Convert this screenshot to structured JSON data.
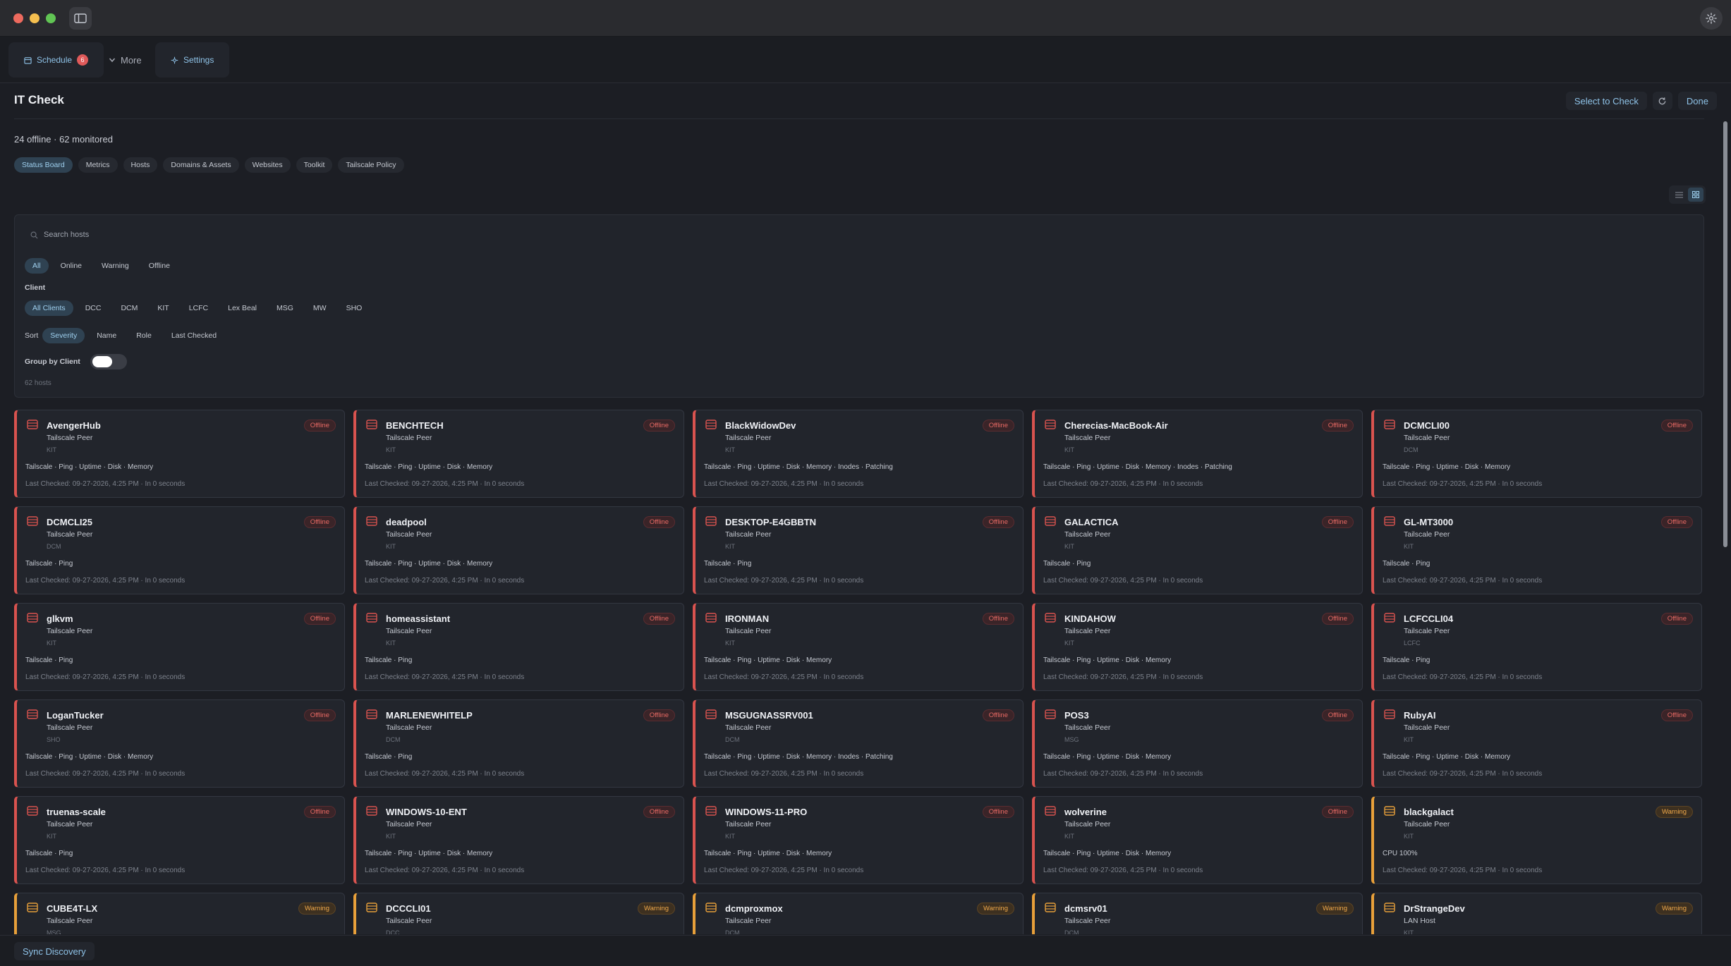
{
  "app": {
    "tabs": {
      "schedule_label": "Schedule",
      "schedule_badge": "6",
      "more_label": "More",
      "settings_label": "Settings"
    }
  },
  "header": {
    "title": "IT Check",
    "select_to_check": "Select to Check",
    "done": "Done",
    "summary": "24 offline · 62 monitored"
  },
  "view_tabs": [
    "Status Board",
    "Metrics",
    "Hosts",
    "Domains & Assets",
    "Websites",
    "Toolkit",
    "Tailscale Policy"
  ],
  "filters": {
    "search_placeholder": "Search hosts",
    "status": [
      "All",
      "Online",
      "Warning",
      "Offline"
    ],
    "client_label": "Client",
    "clients": [
      "All Clients",
      "DCC",
      "DCM",
      "KIT",
      "LCFC",
      "Lex Beal",
      "MSG",
      "MW",
      "SHO"
    ],
    "sort_label": "Sort",
    "sort": [
      "Severity",
      "Name",
      "Role",
      "Last Checked"
    ],
    "group_by_label": "Group by Client",
    "host_count": "62 hosts"
  },
  "hosts": [
    {
      "name": "AvengerHub",
      "role": "Tailscale Peer",
      "client": "KIT",
      "checks": "Tailscale · Ping · Uptime · Disk · Memory",
      "last_checked": "Last Checked: 09-27-2026, 4:25 PM · In 0 seconds",
      "status": "Offline"
    },
    {
      "name": "BENCHTECH",
      "role": "Tailscale Peer",
      "client": "KIT",
      "checks": "Tailscale · Ping · Uptime · Disk · Memory",
      "last_checked": "Last Checked: 09-27-2026, 4:25 PM · In 0 seconds",
      "status": "Offline"
    },
    {
      "name": "BlackWidowDev",
      "role": "Tailscale Peer",
      "client": "KIT",
      "checks": "Tailscale · Ping · Uptime · Disk · Memory · Inodes · Patching",
      "last_checked": "Last Checked: 09-27-2026, 4:25 PM · In 0 seconds",
      "status": "Offline"
    },
    {
      "name": "Cherecias-MacBook-Air",
      "role": "Tailscale Peer",
      "client": "KIT",
      "checks": "Tailscale · Ping · Uptime · Disk · Memory · Inodes · Patching",
      "last_checked": "Last Checked: 09-27-2026, 4:25 PM · In 0 seconds",
      "status": "Offline"
    },
    {
      "name": "DCMCLI00",
      "role": "Tailscale Peer",
      "client": "DCM",
      "checks": "Tailscale · Ping · Uptime · Disk · Memory",
      "last_checked": "Last Checked: 09-27-2026, 4:25 PM · In 0 seconds",
      "status": "Offline"
    },
    {
      "name": "DCMCLI25",
      "role": "Tailscale Peer",
      "client": "DCM",
      "checks": "Tailscale · Ping",
      "last_checked": "Last Checked: 09-27-2026, 4:25 PM · In 0 seconds",
      "status": "Offline"
    },
    {
      "name": "deadpool",
      "role": "Tailscale Peer",
      "client": "KIT",
      "checks": "Tailscale · Ping · Uptime · Disk · Memory",
      "last_checked": "Last Checked: 09-27-2026, 4:25 PM · In 0 seconds",
      "status": "Offline"
    },
    {
      "name": "DESKTOP-E4GBBTN",
      "role": "Tailscale Peer",
      "client": "KIT",
      "checks": "Tailscale · Ping",
      "last_checked": "Last Checked: 09-27-2026, 4:25 PM · In 0 seconds",
      "status": "Offline"
    },
    {
      "name": "GALACTICA",
      "role": "Tailscale Peer",
      "client": "KIT",
      "checks": "Tailscale · Ping",
      "last_checked": "Last Checked: 09-27-2026, 4:25 PM · In 0 seconds",
      "status": "Offline"
    },
    {
      "name": "GL-MT3000",
      "role": "Tailscale Peer",
      "client": "KIT",
      "checks": "Tailscale · Ping",
      "last_checked": "Last Checked: 09-27-2026, 4:25 PM · In 0 seconds",
      "status": "Offline"
    },
    {
      "name": "glkvm",
      "role": "Tailscale Peer",
      "client": "KIT",
      "checks": "Tailscale · Ping",
      "last_checked": "Last Checked: 09-27-2026, 4:25 PM · In 0 seconds",
      "status": "Offline"
    },
    {
      "name": "homeassistant",
      "role": "Tailscale Peer",
      "client": "KIT",
      "checks": "Tailscale · Ping",
      "last_checked": "Last Checked: 09-27-2026, 4:25 PM · In 0 seconds",
      "status": "Offline"
    },
    {
      "name": "IRONMAN",
      "role": "Tailscale Peer",
      "client": "KIT",
      "checks": "Tailscale · Ping · Uptime · Disk · Memory",
      "last_checked": "Last Checked: 09-27-2026, 4:25 PM · In 0 seconds",
      "status": "Offline"
    },
    {
      "name": "KINDAHOW",
      "role": "Tailscale Peer",
      "client": "KIT",
      "checks": "Tailscale · Ping · Uptime · Disk · Memory",
      "last_checked": "Last Checked: 09-27-2026, 4:25 PM · In 0 seconds",
      "status": "Offline"
    },
    {
      "name": "LCFCCLI04",
      "role": "Tailscale Peer",
      "client": "LCFC",
      "checks": "Tailscale · Ping",
      "last_checked": "Last Checked: 09-27-2026, 4:25 PM · In 0 seconds",
      "status": "Offline"
    },
    {
      "name": "LoganTucker",
      "role": "Tailscale Peer",
      "client": "SHO",
      "checks": "Tailscale · Ping · Uptime · Disk · Memory",
      "last_checked": "Last Checked: 09-27-2026, 4:25 PM · In 0 seconds",
      "status": "Offline"
    },
    {
      "name": "MARLENEWHITELP",
      "role": "Tailscale Peer",
      "client": "DCM",
      "checks": "Tailscale · Ping",
      "last_checked": "Last Checked: 09-27-2026, 4:25 PM · In 0 seconds",
      "status": "Offline"
    },
    {
      "name": "MSGUGNASSRV001",
      "role": "Tailscale Peer",
      "client": "DCM",
      "checks": "Tailscale · Ping · Uptime · Disk · Memory · Inodes · Patching",
      "last_checked": "Last Checked: 09-27-2026, 4:25 PM · In 0 seconds",
      "status": "Offline"
    },
    {
      "name": "POS3",
      "role": "Tailscale Peer",
      "client": "MSG",
      "checks": "Tailscale · Ping · Uptime · Disk · Memory",
      "last_checked": "Last Checked: 09-27-2026, 4:25 PM · In 0 seconds",
      "status": "Offline"
    },
    {
      "name": "RubyAI",
      "role": "Tailscale Peer",
      "client": "KIT",
      "checks": "Tailscale · Ping · Uptime · Disk · Memory",
      "last_checked": "Last Checked: 09-27-2026, 4:25 PM · In 0 seconds",
      "status": "Offline"
    },
    {
      "name": "truenas-scale",
      "role": "Tailscale Peer",
      "client": "KIT",
      "checks": "Tailscale · Ping",
      "last_checked": "Last Checked: 09-27-2026, 4:25 PM · In 0 seconds",
      "status": "Offline"
    },
    {
      "name": "WINDOWS-10-ENT",
      "role": "Tailscale Peer",
      "client": "KIT",
      "checks": "Tailscale · Ping · Uptime · Disk · Memory",
      "last_checked": "Last Checked: 09-27-2026, 4:25 PM · In 0 seconds",
      "status": "Offline"
    },
    {
      "name": "WINDOWS-11-PRO",
      "role": "Tailscale Peer",
      "client": "KIT",
      "checks": "Tailscale · Ping · Uptime · Disk · Memory",
      "last_checked": "Last Checked: 09-27-2026, 4:25 PM · In 0 seconds",
      "status": "Offline"
    },
    {
      "name": "wolverine",
      "role": "Tailscale Peer",
      "client": "KIT",
      "checks": "Tailscale · Ping · Uptime · Disk · Memory",
      "last_checked": "Last Checked: 09-27-2026, 4:25 PM · In 0 seconds",
      "status": "Offline"
    },
    {
      "name": "blackgalact",
      "role": "Tailscale Peer",
      "client": "KIT",
      "checks": "CPU 100%",
      "last_checked": "Last Checked: 09-27-2026, 4:25 PM · In 0 seconds",
      "status": "Warning"
    },
    {
      "name": "CUBE4T-LX",
      "role": "Tailscale Peer",
      "client": "MSG",
      "checks": "",
      "last_checked": "",
      "status": "Warning"
    },
    {
      "name": "DCCCLI01",
      "role": "Tailscale Peer",
      "client": "DCC",
      "checks": "",
      "last_checked": "",
      "status": "Warning"
    },
    {
      "name": "dcmproxmox",
      "role": "Tailscale Peer",
      "client": "DCM",
      "checks": "",
      "last_checked": "",
      "status": "Warning"
    },
    {
      "name": "dcmsrv01",
      "role": "Tailscale Peer",
      "client": "DCM",
      "checks": "",
      "last_checked": "",
      "status": "Warning"
    },
    {
      "name": "DrStrangeDev",
      "role": "LAN Host",
      "client": "KIT",
      "checks": "",
      "last_checked": "",
      "status": "Warning"
    }
  ],
  "footer": {
    "sync_label": "Sync Discovery"
  },
  "colors": {
    "offline": "#d9534f",
    "warning": "#e8a03a",
    "accent": "#8fc3e8"
  },
  "icons": {
    "sidebar": "sidebar-icon",
    "settings": "gear-icon",
    "calendar": "calendar-icon",
    "chevron": "chevron-down-icon",
    "refresh": "refresh-icon",
    "search": "search-icon",
    "list_view": "list-view-icon",
    "grid_view": "grid-view-icon",
    "host": "server-icon"
  }
}
